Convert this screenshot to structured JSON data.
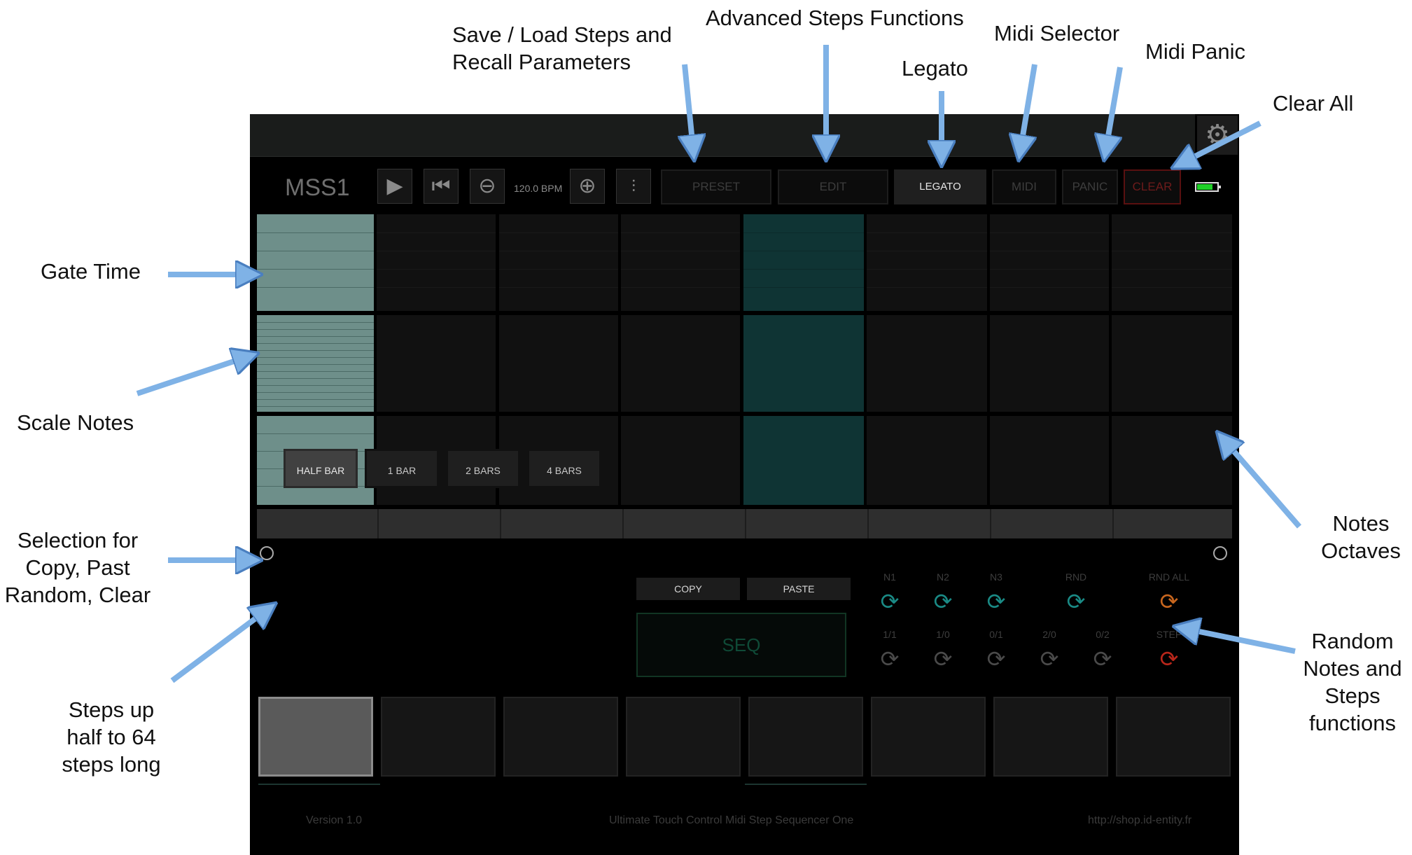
{
  "annotations": {
    "save_load": "Save / Load Steps and\nRecall Parameters",
    "advanced": "Advanced Steps Functions",
    "legato": "Legato",
    "midi_selector": "Midi Selector",
    "midi_panic": "Midi Panic",
    "clear_all": "Clear All",
    "gate_time": "Gate Time",
    "scale_notes": "Scale Notes",
    "selection": "Selection for\nCopy, Past\nRandom, Clear",
    "steps_long": "Steps up\nhalf to 64\nsteps long",
    "notes_octaves": "Notes\nOctaves",
    "random_functions": "Random\nNotes and\nSteps\nfunctions"
  },
  "app": {
    "title": "MSS1",
    "bpm": "120.0 BPM",
    "transport": {
      "play_icon": "play-icon",
      "rewind_icon": "rewind-icon",
      "minus_icon": "minus-icon",
      "plus_icon": "plus-icon",
      "mixer_icon": "mixer-icon",
      "gear_icon": "gear-icon"
    },
    "buttons": {
      "preset": "PRESET",
      "edit": "EDIT",
      "legato": "LEGATO",
      "midi": "MIDI",
      "panic": "PANIC",
      "clear": "CLEAR"
    },
    "length_buttons": [
      "HALF BAR",
      "1 BAR",
      "2 BARS",
      "4 BARS"
    ],
    "length_selected": "HALF BAR",
    "copy": "COPY",
    "paste": "PASTE",
    "seq": "SEQ",
    "random_top": [
      "N1",
      "N2",
      "N3",
      "RND",
      "RND ALL"
    ],
    "random_bottom": [
      "1/1",
      "1/0",
      "0/1",
      "2/0",
      "0/2",
      "STEP"
    ],
    "footer": {
      "version": "Version 1.0",
      "name": "Ultimate Touch Control Midi Step Sequencer One",
      "url": "http://shop.id-entity.fr"
    },
    "colors": {
      "clear_red": "#6e1b1b",
      "battery_green": "#1fd128",
      "active_step": "#6e8f8a",
      "play_column": "#0f3434",
      "random_teal": "#1a8a85",
      "random_orange": "#c8661e",
      "step_red": "#b8261a",
      "seq_green": "#0f4a37"
    }
  }
}
